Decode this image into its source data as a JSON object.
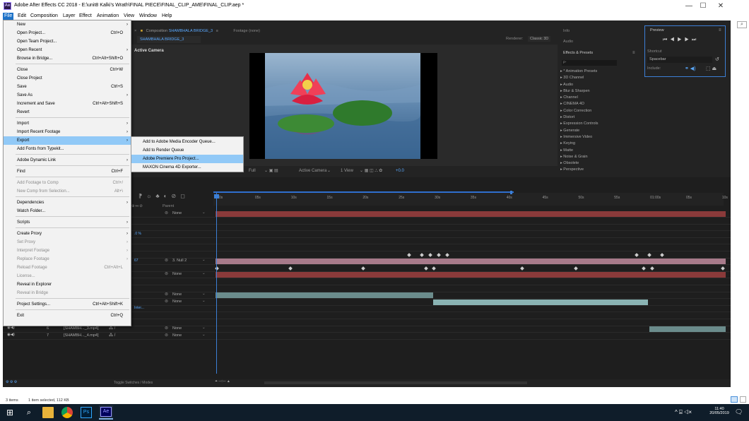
{
  "window": {
    "app_icon": "Ae",
    "title": "Adobe After Effects CC 2018 - E:\\unit8 Kalki's Wrath\\FINAL PIECE\\FINAL_CLIP_AME\\FINAL_CLIP.aep *",
    "minimize": "—",
    "maximize": "☐",
    "close": "✕"
  },
  "menubar": [
    "File",
    "Edit",
    "Composition",
    "Layer",
    "Effect",
    "Animation",
    "View",
    "Window",
    "Help"
  ],
  "file_menu": [
    {
      "label": "New",
      "shortcut": "",
      "arrow": true,
      "disabled": false
    },
    {
      "label": "Open Project...",
      "shortcut": "Ctrl+O",
      "arrow": false,
      "disabled": false
    },
    {
      "label": "Open Team Project...",
      "shortcut": "",
      "arrow": false,
      "disabled": false
    },
    {
      "label": "Open Recent",
      "shortcut": "",
      "arrow": true,
      "disabled": false
    },
    {
      "label": "Browse in Bridge...",
      "shortcut": "Ctrl+Alt+Shift+O",
      "arrow": false,
      "disabled": false,
      "sep_after": true
    },
    {
      "label": "Close",
      "shortcut": "Ctrl+W",
      "arrow": false,
      "disabled": false
    },
    {
      "label": "Close Project",
      "shortcut": "",
      "arrow": false,
      "disabled": false
    },
    {
      "label": "Save",
      "shortcut": "Ctrl+S",
      "arrow": false,
      "disabled": false
    },
    {
      "label": "Save As",
      "shortcut": "",
      "arrow": true,
      "disabled": false
    },
    {
      "label": "Increment and Save",
      "shortcut": "Ctrl+Alt+Shift+S",
      "arrow": false,
      "disabled": false
    },
    {
      "label": "Revert",
      "shortcut": "",
      "arrow": false,
      "disabled": false,
      "sep_after": true
    },
    {
      "label": "Import",
      "shortcut": "",
      "arrow": true,
      "disabled": false
    },
    {
      "label": "Import Recent Footage",
      "shortcut": "",
      "arrow": true,
      "disabled": false
    },
    {
      "label": "Export",
      "shortcut": "",
      "arrow": true,
      "disabled": false,
      "highlight": true
    },
    {
      "label": "Add Fonts from Typekit...",
      "shortcut": "",
      "arrow": false,
      "disabled": false,
      "sep_after": true
    },
    {
      "label": "Adobe Dynamic Link",
      "shortcut": "",
      "arrow": true,
      "disabled": false,
      "sep_after": true
    },
    {
      "label": "Find",
      "shortcut": "Ctrl+F",
      "arrow": false,
      "disabled": false,
      "sep_after": true
    },
    {
      "label": "Add Footage to Comp",
      "shortcut": "Ctrl+/",
      "arrow": false,
      "disabled": true
    },
    {
      "label": "New Comp from Selection...",
      "shortcut": "Alt+\\",
      "arrow": false,
      "disabled": true,
      "sep_after": true
    },
    {
      "label": "Dependencies",
      "shortcut": "",
      "arrow": true,
      "disabled": false
    },
    {
      "label": "Watch Folder...",
      "shortcut": "",
      "arrow": false,
      "disabled": false,
      "sep_after": true
    },
    {
      "label": "Scripts",
      "shortcut": "",
      "arrow": true,
      "disabled": false,
      "sep_after": true
    },
    {
      "label": "Create Proxy",
      "shortcut": "",
      "arrow": true,
      "disabled": false
    },
    {
      "label": "Set Proxy",
      "shortcut": "",
      "arrow": true,
      "disabled": true
    },
    {
      "label": "Interpret Footage",
      "shortcut": "",
      "arrow": true,
      "disabled": true
    },
    {
      "label": "Replace Footage",
      "shortcut": "",
      "arrow": true,
      "disabled": true
    },
    {
      "label": "Reload Footage",
      "shortcut": "Ctrl+Alt+L",
      "arrow": false,
      "disabled": true
    },
    {
      "label": "License...",
      "shortcut": "",
      "arrow": false,
      "disabled": true
    },
    {
      "label": "Reveal in Explorer",
      "shortcut": "",
      "arrow": false,
      "disabled": false
    },
    {
      "label": "Reveal in Bridge",
      "shortcut": "",
      "arrow": false,
      "disabled": true,
      "sep_after": true
    },
    {
      "label": "Project Settings...",
      "shortcut": "Ctrl+Alt+Shift+K",
      "arrow": false,
      "disabled": false,
      "sep_after": true
    },
    {
      "label": "Exit",
      "shortcut": "Ctrl+Q",
      "arrow": false,
      "disabled": false
    }
  ],
  "export_submenu": [
    {
      "label": "Add to Adobe Media Encoder Queue...",
      "highlight": false
    },
    {
      "label": "Add to Render Queue",
      "highlight": false
    },
    {
      "label": "Adobe Premiere Pro Project...",
      "highlight": true
    },
    {
      "label": "MAXON Cinema 4D Exporter...",
      "highlight": false
    }
  ],
  "comp_panel": {
    "tab_prefix": "Composition",
    "comp_name": "SHAMBHALA BRIDGE_3",
    "footage_tab": "Footage (none)",
    "subtab": "SHAMBHALA BRIDGE_3",
    "renderer_label": "Renderer:",
    "renderer_value": "Classic 3D",
    "camera_label": "Active Camera",
    "resolution": "Full",
    "view_camera": "Active Camera",
    "view_count": "1 View",
    "exposure": "+0.0"
  },
  "right_panels": {
    "info": "Info",
    "audio": "Audio",
    "effects_title": "Effects & Presets",
    "search_placeholder": "ρ-",
    "effects": [
      "* Animation Presets",
      "3D Channel",
      "Audio",
      "Blur & Sharpen",
      "Channel",
      "CINEMA 4D",
      "Color Correction",
      "Distort",
      "Expression Controls",
      "Generate",
      "Immersive Video",
      "Keying",
      "Matte",
      "Noise & Grain",
      "Obsolete",
      "Perspective"
    ],
    "preview_title": "Preview",
    "shortcut_label": "Shortcut",
    "shortcut_value": "Spacebar",
    "include_label": "Include:"
  },
  "timeline": {
    "ticks": [
      "0s",
      "05s",
      "10s",
      "15s",
      "20s",
      "25s",
      "30s",
      "35s",
      "40s",
      "45s",
      "50s",
      "55s",
      "01:00s",
      "05s",
      "10s"
    ],
    "parent_header": "Parent",
    "partial_labels": [
      ".0 %",
      "67",
      "Inter..."
    ],
    "parent_values": [
      "None",
      "3. Null 2",
      "None",
      "None",
      "None",
      "None",
      "None"
    ],
    "audio_label": "Audio",
    "layers": [
      {
        "num": "6",
        "name": "[SHAMBH..._3.mp4]"
      },
      {
        "num": "7",
        "name": "[SHAMBH..._4.mp4]"
      }
    ],
    "toggle_label": "Toggle Switches / Modes"
  },
  "statusbar": {
    "items": "3 items",
    "selected": "1 item selected, 112 KB"
  },
  "taskbar": {
    "time": "11:40",
    "date": "20/05/2019",
    "notif_count": "1"
  }
}
